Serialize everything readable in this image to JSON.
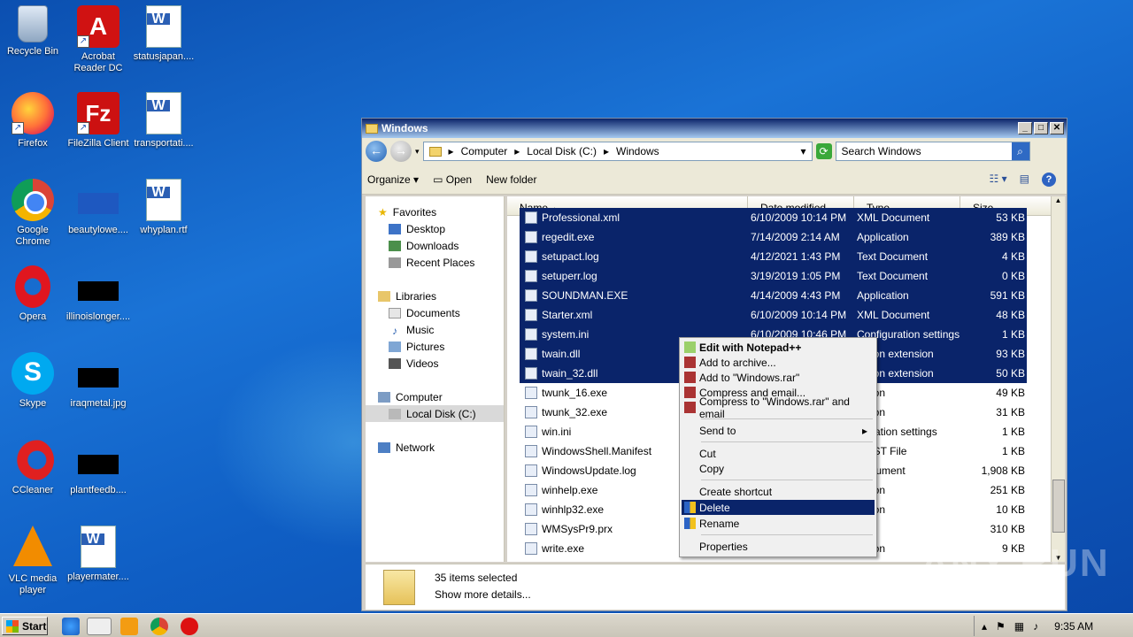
{
  "desktop": {
    "icons": [
      {
        "label": "Recycle Bin",
        "icon": "recycle-bin-icon"
      },
      {
        "label": "Acrobat Reader DC",
        "icon": "acrobat-icon"
      },
      {
        "label": "statusjapan....",
        "icon": "word-doc-icon"
      },
      {
        "label": "Firefox",
        "icon": "firefox-icon"
      },
      {
        "label": "FileZilla Client",
        "icon": "filezilla-icon"
      },
      {
        "label": "transportati....",
        "icon": "word-doc-icon"
      },
      {
        "label": "Google Chrome",
        "icon": "chrome-icon"
      },
      {
        "label": "beautylowe....",
        "icon": "file-icon"
      },
      {
        "label": "whyplan.rtf",
        "icon": "word-doc-icon"
      },
      {
        "label": "Opera",
        "icon": "opera-icon"
      },
      {
        "label": "illinoislonger....",
        "icon": "file-icon"
      },
      {
        "label": "Skype",
        "icon": "skype-icon"
      },
      {
        "label": "iraqmetal.jpg",
        "icon": "image-icon"
      },
      {
        "label": "CCleaner",
        "icon": "ccleaner-icon"
      },
      {
        "label": "plantfeedb....",
        "icon": "file-icon"
      },
      {
        "label": "VLC media player",
        "icon": "vlc-icon"
      },
      {
        "label": "playermater....",
        "icon": "word-doc-icon"
      }
    ]
  },
  "window": {
    "title": "Windows",
    "minimize": "_",
    "maximize": "□",
    "close": "✕"
  },
  "address": {
    "crumbs": [
      "Computer",
      "Local Disk (C:)",
      "Windows"
    ],
    "search_placeholder": "Search Windows"
  },
  "toolbar": {
    "organize": "Organize",
    "open": "Open",
    "new_folder": "New folder"
  },
  "nav": {
    "favorites": "Favorites",
    "desktop": "Desktop",
    "downloads": "Downloads",
    "recent": "Recent Places",
    "libraries": "Libraries",
    "documents": "Documents",
    "music": "Music",
    "pictures": "Pictures",
    "videos": "Videos",
    "computer": "Computer",
    "local_disk": "Local Disk (C:)",
    "network": "Network"
  },
  "columns": {
    "name": "Name",
    "date": "Date modified",
    "type": "Type",
    "size": "Size"
  },
  "files": [
    {
      "name": "Professional.xml",
      "date": "6/10/2009 10:14 PM",
      "type": "XML Document",
      "size": "53 KB",
      "selected": true
    },
    {
      "name": "regedit.exe",
      "date": "7/14/2009 2:14 AM",
      "type": "Application",
      "size": "389 KB",
      "selected": true
    },
    {
      "name": "setupact.log",
      "date": "4/12/2021 1:43 PM",
      "type": "Text Document",
      "size": "4 KB",
      "selected": true
    },
    {
      "name": "setuperr.log",
      "date": "3/19/2019 1:05 PM",
      "type": "Text Document",
      "size": "0 KB",
      "selected": true
    },
    {
      "name": "SOUNDMAN.EXE",
      "date": "4/14/2009 4:43 PM",
      "type": "Application",
      "size": "591 KB",
      "selected": true
    },
    {
      "name": "Starter.xml",
      "date": "6/10/2009 10:14 PM",
      "type": "XML Document",
      "size": "48 KB",
      "selected": true
    },
    {
      "name": "system.ini",
      "date": "6/10/2009 10:46 PM",
      "type": "Configuration settings",
      "size": "1 KB",
      "selected": true
    },
    {
      "name": "twain.dll",
      "date": "",
      "type": "cation extension",
      "size": "93 KB",
      "selected": true
    },
    {
      "name": "twain_32.dll",
      "date": "",
      "type": "cation extension",
      "size": "50 KB",
      "selected": true
    },
    {
      "name": "twunk_16.exe",
      "date": "",
      "type": "cation",
      "size": "49 KB",
      "selected": false
    },
    {
      "name": "twunk_32.exe",
      "date": "",
      "type": "cation",
      "size": "31 KB",
      "selected": false
    },
    {
      "name": "win.ini",
      "date": "",
      "type": "iguration settings",
      "size": "1 KB",
      "selected": false
    },
    {
      "name": "WindowsShell.Manifest",
      "date": "",
      "type": "IFEST File",
      "size": "1 KB",
      "selected": false
    },
    {
      "name": "WindowsUpdate.log",
      "date": "",
      "type": "Document",
      "size": "1,908 KB",
      "selected": false
    },
    {
      "name": "winhelp.exe",
      "date": "",
      "type": "cation",
      "size": "251 KB",
      "selected": false
    },
    {
      "name": "winhlp32.exe",
      "date": "",
      "type": "cation",
      "size": "10 KB",
      "selected": false
    },
    {
      "name": "WMSysPr9.prx",
      "date": "",
      "type": "File",
      "size": "310 KB",
      "selected": false
    },
    {
      "name": "write.exe",
      "date": "",
      "type": "cation",
      "size": "9 KB",
      "selected": false
    }
  ],
  "details": {
    "count": "35 items selected",
    "more": "Show more details..."
  },
  "context_menu": {
    "edit_notepad": "Edit with Notepad++",
    "add_archive": "Add to archive...",
    "add_rar": "Add to \"Windows.rar\"",
    "compress_email": "Compress and email...",
    "compress_rar_email": "Compress to \"Windows.rar\" and email",
    "send_to": "Send to",
    "cut": "Cut",
    "copy": "Copy",
    "create_shortcut": "Create shortcut",
    "delete": "Delete",
    "rename": "Rename",
    "properties": "Properties"
  },
  "taskbar": {
    "start": "Start",
    "time": "9:35 AM"
  },
  "watermark": "ANY RUN"
}
